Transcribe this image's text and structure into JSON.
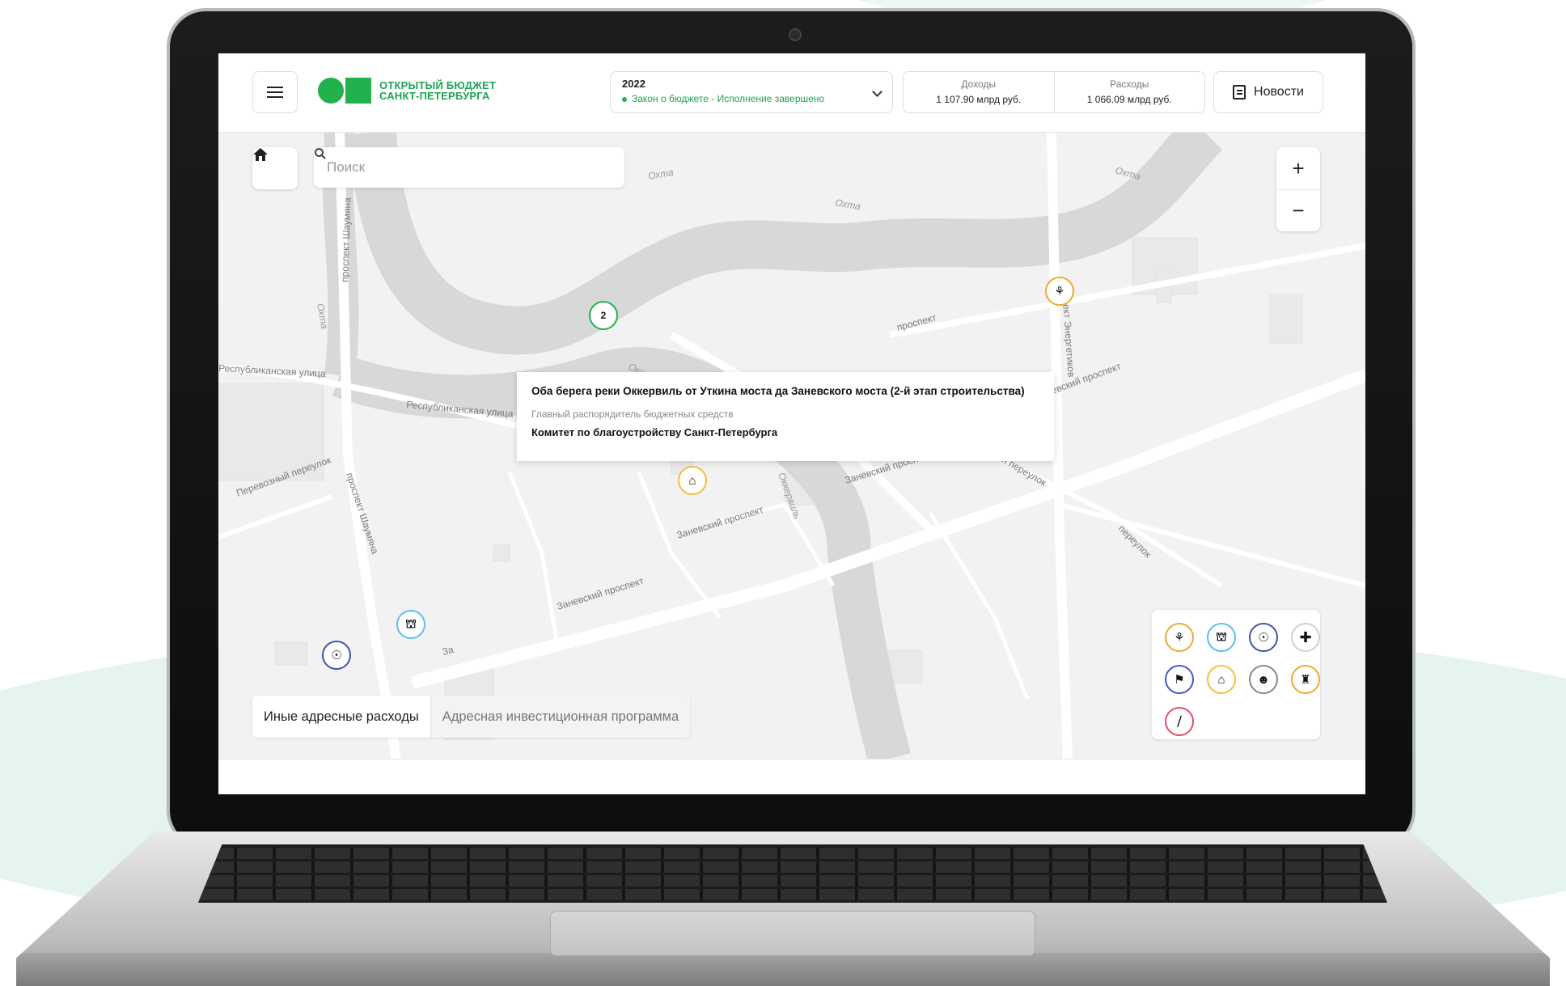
{
  "header": {
    "menu_icon": "menu-icon",
    "logo_line1": "ОТКРЫТЫЙ БЮДЖЕТ",
    "logo_line2": "САНКТ-ПЕТЕРБУРГА",
    "year": "2022",
    "budget_status": "Закон о бюджете - Исполнение завершено",
    "income_label": "Доходы",
    "income_value": "1 107.90 млрд руб.",
    "expense_label": "Расходы",
    "expense_value": "1 066.09 млрд руб.",
    "news_label": "Новости",
    "accent_color": "#22b14c"
  },
  "map": {
    "search_placeholder": "Поиск",
    "zoom_in": "+",
    "zoom_out": "−",
    "street_labels": {
      "okhta1": "Охта",
      "okhta2": "Охта",
      "okhta3": "Охта",
      "okhta4": "Охта",
      "shaumyana1": "проспект Шаумяна",
      "shaumyana2": "проспект Шаумяна",
      "respublikanskaya1": "Республиканская улица",
      "respublikanskaya2": "Республиканская улица",
      "perevozny": "Перевозный переулок",
      "zanevsky1": "Заневский проспект",
      "zanevsky2": "Заневский проспект",
      "zanevsky3": "Заневский проспект",
      "zanevsky4": "Заневский проспект",
      "okkervil1": "Оккервиль",
      "okkervil2": "Оккервиль",
      "energetikov": "проспект Энергетиков",
      "utkin": "Уткин переулок",
      "prospekt": "проспект",
      "pereulok": "переулок",
      "za": "За"
    },
    "cluster_count": "2",
    "tooltip": {
      "title": "Оба берега реки Оккервиль от Уткина моста да Заневского моста (2-й этап строительства)",
      "label": "Главный распорядитель бюджетных средств",
      "org": "Комитет по благоустройству Санкт-Петербурга"
    }
  },
  "legend": {
    "items": [
      {
        "icon": "tree-icon",
        "color": "#f0a830"
      },
      {
        "icon": "museum-icon",
        "color": "#5bc0eb"
      },
      {
        "icon": "microscope-icon",
        "color": "#3f51b5"
      },
      {
        "icon": "medical-cross-icon",
        "color": "#d0d0d0"
      },
      {
        "icon": "flag-icon",
        "color": "#4a55c9"
      },
      {
        "icon": "house-icon",
        "color": "#f0c040"
      },
      {
        "icon": "people-icon",
        "color": "#888888"
      },
      {
        "icon": "lock-icon",
        "color": "#f0a830"
      },
      {
        "icon": "road-icon",
        "color": "#e84a6a"
      }
    ]
  },
  "tabs": {
    "active": "Иные адресные расходы",
    "inactive": "Адресная инвестиционная программа"
  }
}
